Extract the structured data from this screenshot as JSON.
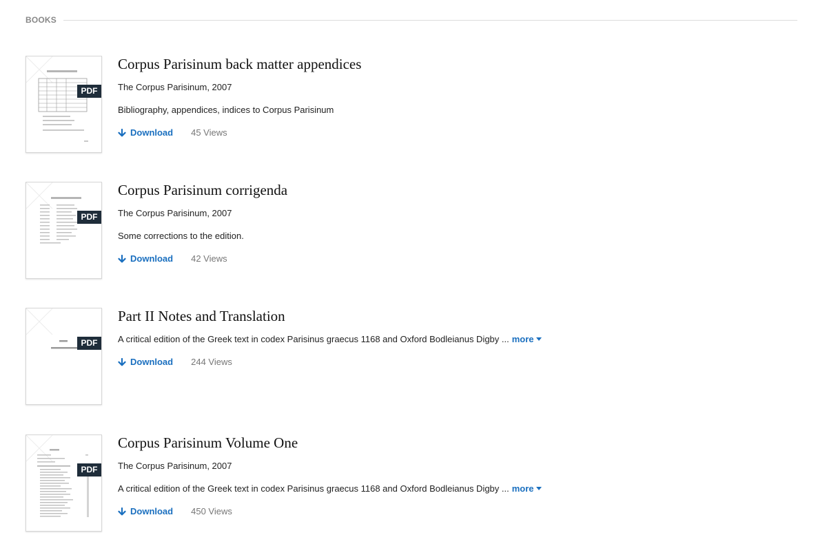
{
  "section": {
    "title": "BOOKS"
  },
  "books": [
    {
      "title": "Corpus Parisinum back matter appendices",
      "meta": "The Corpus Parisinum, 2007",
      "description": "Bibliography, appendices, indices to Corpus Parisinum",
      "badge": "PDF",
      "download_label": "Download",
      "views": "45 Views"
    },
    {
      "title": "Corpus Parisinum corrigenda",
      "meta": "The Corpus Parisinum, 2007",
      "description": "Some corrections to the edition.",
      "badge": "PDF",
      "download_label": "Download",
      "views": "42 Views"
    },
    {
      "title": "Part II Notes and Translation",
      "description": "A critical edition of the Greek text in codex Parisinus graecus 1168 and Oxford Bodleianus Digby ...",
      "more_label": "more",
      "badge": "PDF",
      "download_label": "Download",
      "views": "244 Views"
    },
    {
      "title": "Corpus Parisinum Volume One",
      "meta": "The Corpus Parisinum, 2007",
      "description": "A critical edition of the Greek text in codex Parisinus graecus 1168 and Oxford Bodleianus Digby ...",
      "more_label": "more",
      "badge": "PDF",
      "download_label": "Download",
      "views": "450 Views"
    }
  ],
  "colors": {
    "link": "#1a6fbf",
    "badge_bg": "#1f2d3a",
    "muted": "#777777"
  },
  "icons": {
    "download": "arrow-down-icon",
    "more": "caret-down-icon"
  }
}
